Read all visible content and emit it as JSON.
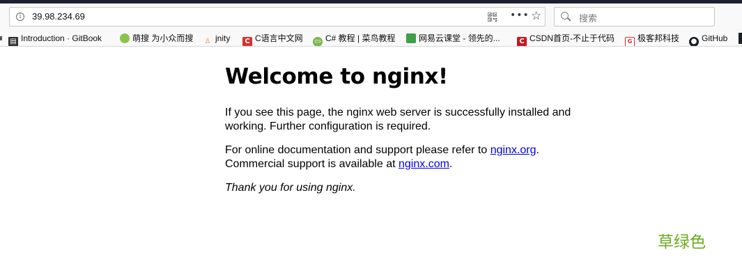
{
  "browser": {
    "url": "39.98.234.69",
    "search_placeholder": "搜索",
    "more_label": "•••"
  },
  "bookmarks": [
    {
      "label": "Introduction · GitBook",
      "icon": "book-icon",
      "color": "#333333"
    },
    {
      "label": "萌搜 为小众而搜",
      "icon": "circle-logo-icon",
      "color": "#8bc34a"
    },
    {
      "label": "jnity",
      "icon": "person-icon",
      "color": "#f4872b"
    },
    {
      "label": "C语言中文网",
      "icon": "c-logo-icon",
      "color": "#d9322f"
    },
    {
      "label": "C# 教程 | 菜鸟教程",
      "icon": "runoob-icon",
      "color": "#7ab851"
    },
    {
      "label": "网易云课堂 - 领先的...",
      "icon": "netease-icon",
      "color": "#3da047"
    },
    {
      "label": "CSDN首页-不止于代码",
      "icon": "csdn-icon",
      "color": "#c9151e"
    },
    {
      "label": "极客邦科技",
      "icon": "geekbang-icon",
      "color": "#e0292d"
    },
    {
      "label": "GitHub",
      "icon": "github-icon",
      "color": "#1b1f23"
    }
  ],
  "page": {
    "title": "Welcome to nginx!",
    "p1": "If you see this page, the nginx web server is successfully installed and working. Further configuration is required.",
    "p2_before": "For online documentation and support please refer to ",
    "link1": "nginx.org",
    "p2_mid": ".",
    "p2_line2": "Commercial support is available at ",
    "link2": "nginx.com",
    "p2_end": ".",
    "p3": "Thank you for using nginx."
  },
  "watermark": "草绿色",
  "colors": {
    "link": "#0000ee",
    "watermark": "#6aab1a"
  }
}
